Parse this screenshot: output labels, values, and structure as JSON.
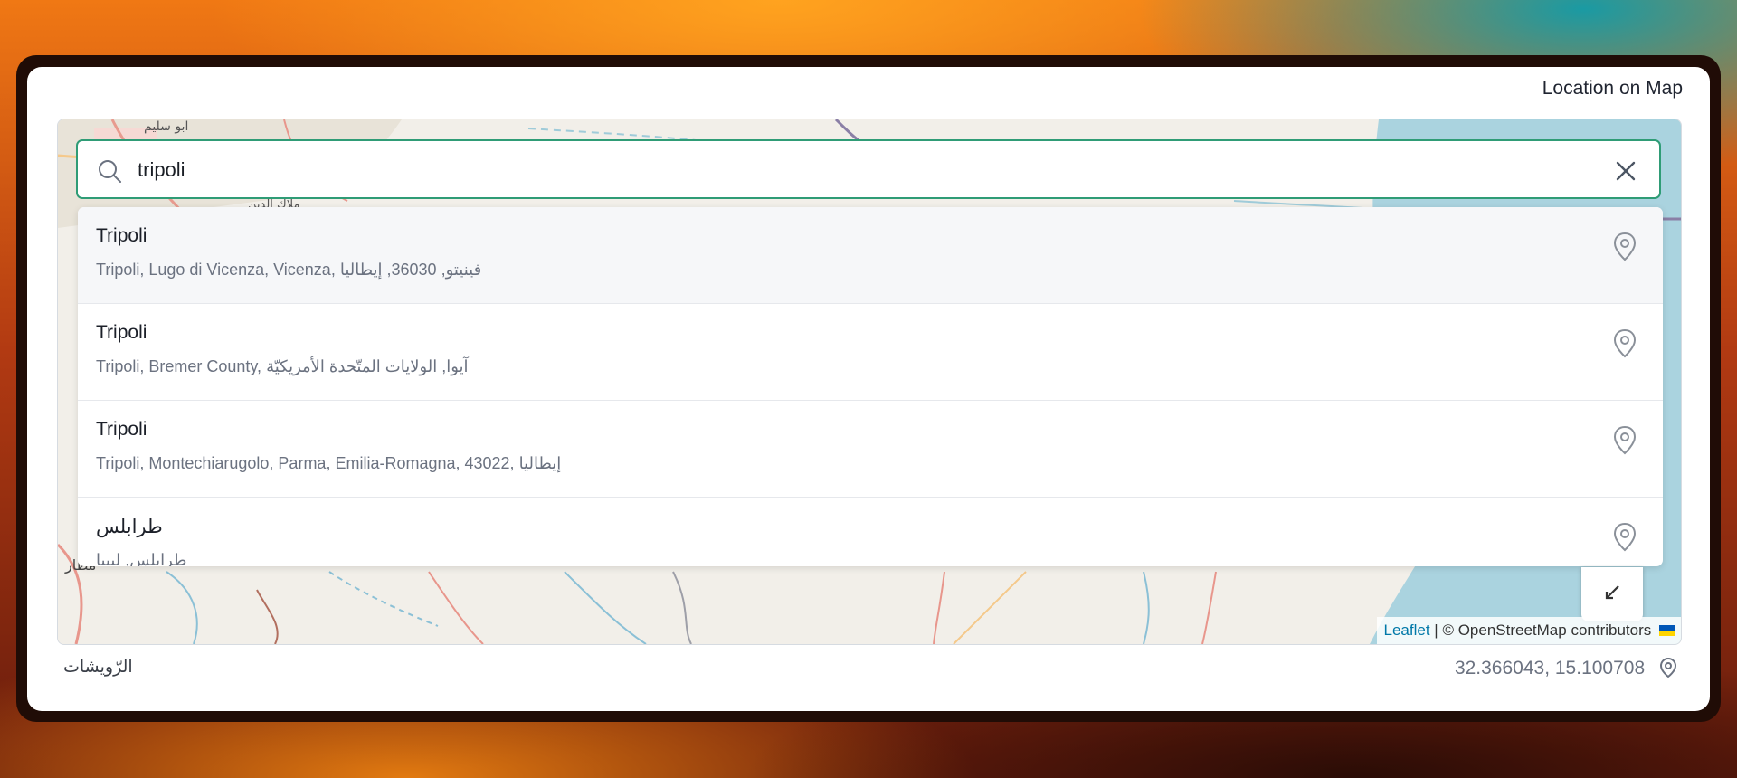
{
  "panel": {
    "title": "Location on Map"
  },
  "search": {
    "value": "tripoli",
    "icon": "search-icon",
    "clear_icon": "close-icon",
    "border_color": "#2f9c76"
  },
  "results": [
    {
      "title": "Tripoli",
      "subtitle": "Tripoli, Lugo di Vicenza, Vicenza, فينيتو, 36030, إيطاليا",
      "icon": "map-pin-icon"
    },
    {
      "title": "Tripoli",
      "subtitle": "Tripoli, Bremer County, آيوا, الولايات المتّحدة الأمريكيّة",
      "icon": "map-pin-icon"
    },
    {
      "title": "Tripoli",
      "subtitle": "Tripoli, Montechiarugolo, Parma, Emilia-Romagna, 43022, إيطاليا",
      "icon": "map-pin-icon"
    },
    {
      "title": "طرابلس",
      "subtitle": "طرابلس, ليبيا",
      "icon": "map-pin-icon"
    }
  ],
  "map_labels": {
    "label_1": "ابو سليم",
    "label_2": "ملاك الدين",
    "label_3": "مطار"
  },
  "attribution": {
    "leaflet": "Leaflet",
    "separator": "|",
    "osm": "© OpenStreetMap contributors"
  },
  "footer": {
    "place_name": "الرّويشات",
    "coordinates": "32.366043, 15.100708",
    "coord_icon": "location-pin-icon"
  }
}
